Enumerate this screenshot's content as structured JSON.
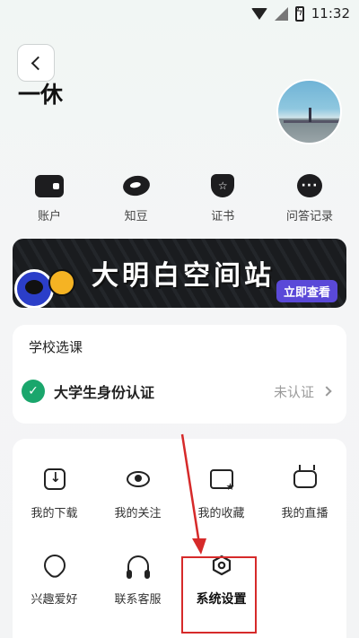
{
  "status_bar": {
    "time": "11:32"
  },
  "header": {
    "username": "一休"
  },
  "quick_links": [
    {
      "label": "账户",
      "icon": "wallet-icon"
    },
    {
      "label": "知豆",
      "icon": "bean-icon"
    },
    {
      "label": "证书",
      "icon": "certificate-icon"
    },
    {
      "label": "问答记录",
      "icon": "chat-bubble-icon"
    }
  ],
  "banner": {
    "title": "大明白空间站",
    "cta": "立即查看"
  },
  "school": {
    "title": "学校选课",
    "verify_label": "大学生身份认证",
    "verify_status": "未认证"
  },
  "grid": [
    {
      "label": "我的下载",
      "icon": "download-icon"
    },
    {
      "label": "我的关注",
      "icon": "eye-icon"
    },
    {
      "label": "我的收藏",
      "icon": "folder-star-icon"
    },
    {
      "label": "我的直播",
      "icon": "tv-icon"
    },
    {
      "label": "兴趣爱好",
      "icon": "heart-pin-icon"
    },
    {
      "label": "联系客服",
      "icon": "headset-icon"
    },
    {
      "label": "系统设置",
      "icon": "settings-hex-icon"
    }
  ],
  "colors": {
    "highlight": "#d62a2a",
    "verify_green": "#1aa66c",
    "banner_cta": "#5a49d8"
  }
}
